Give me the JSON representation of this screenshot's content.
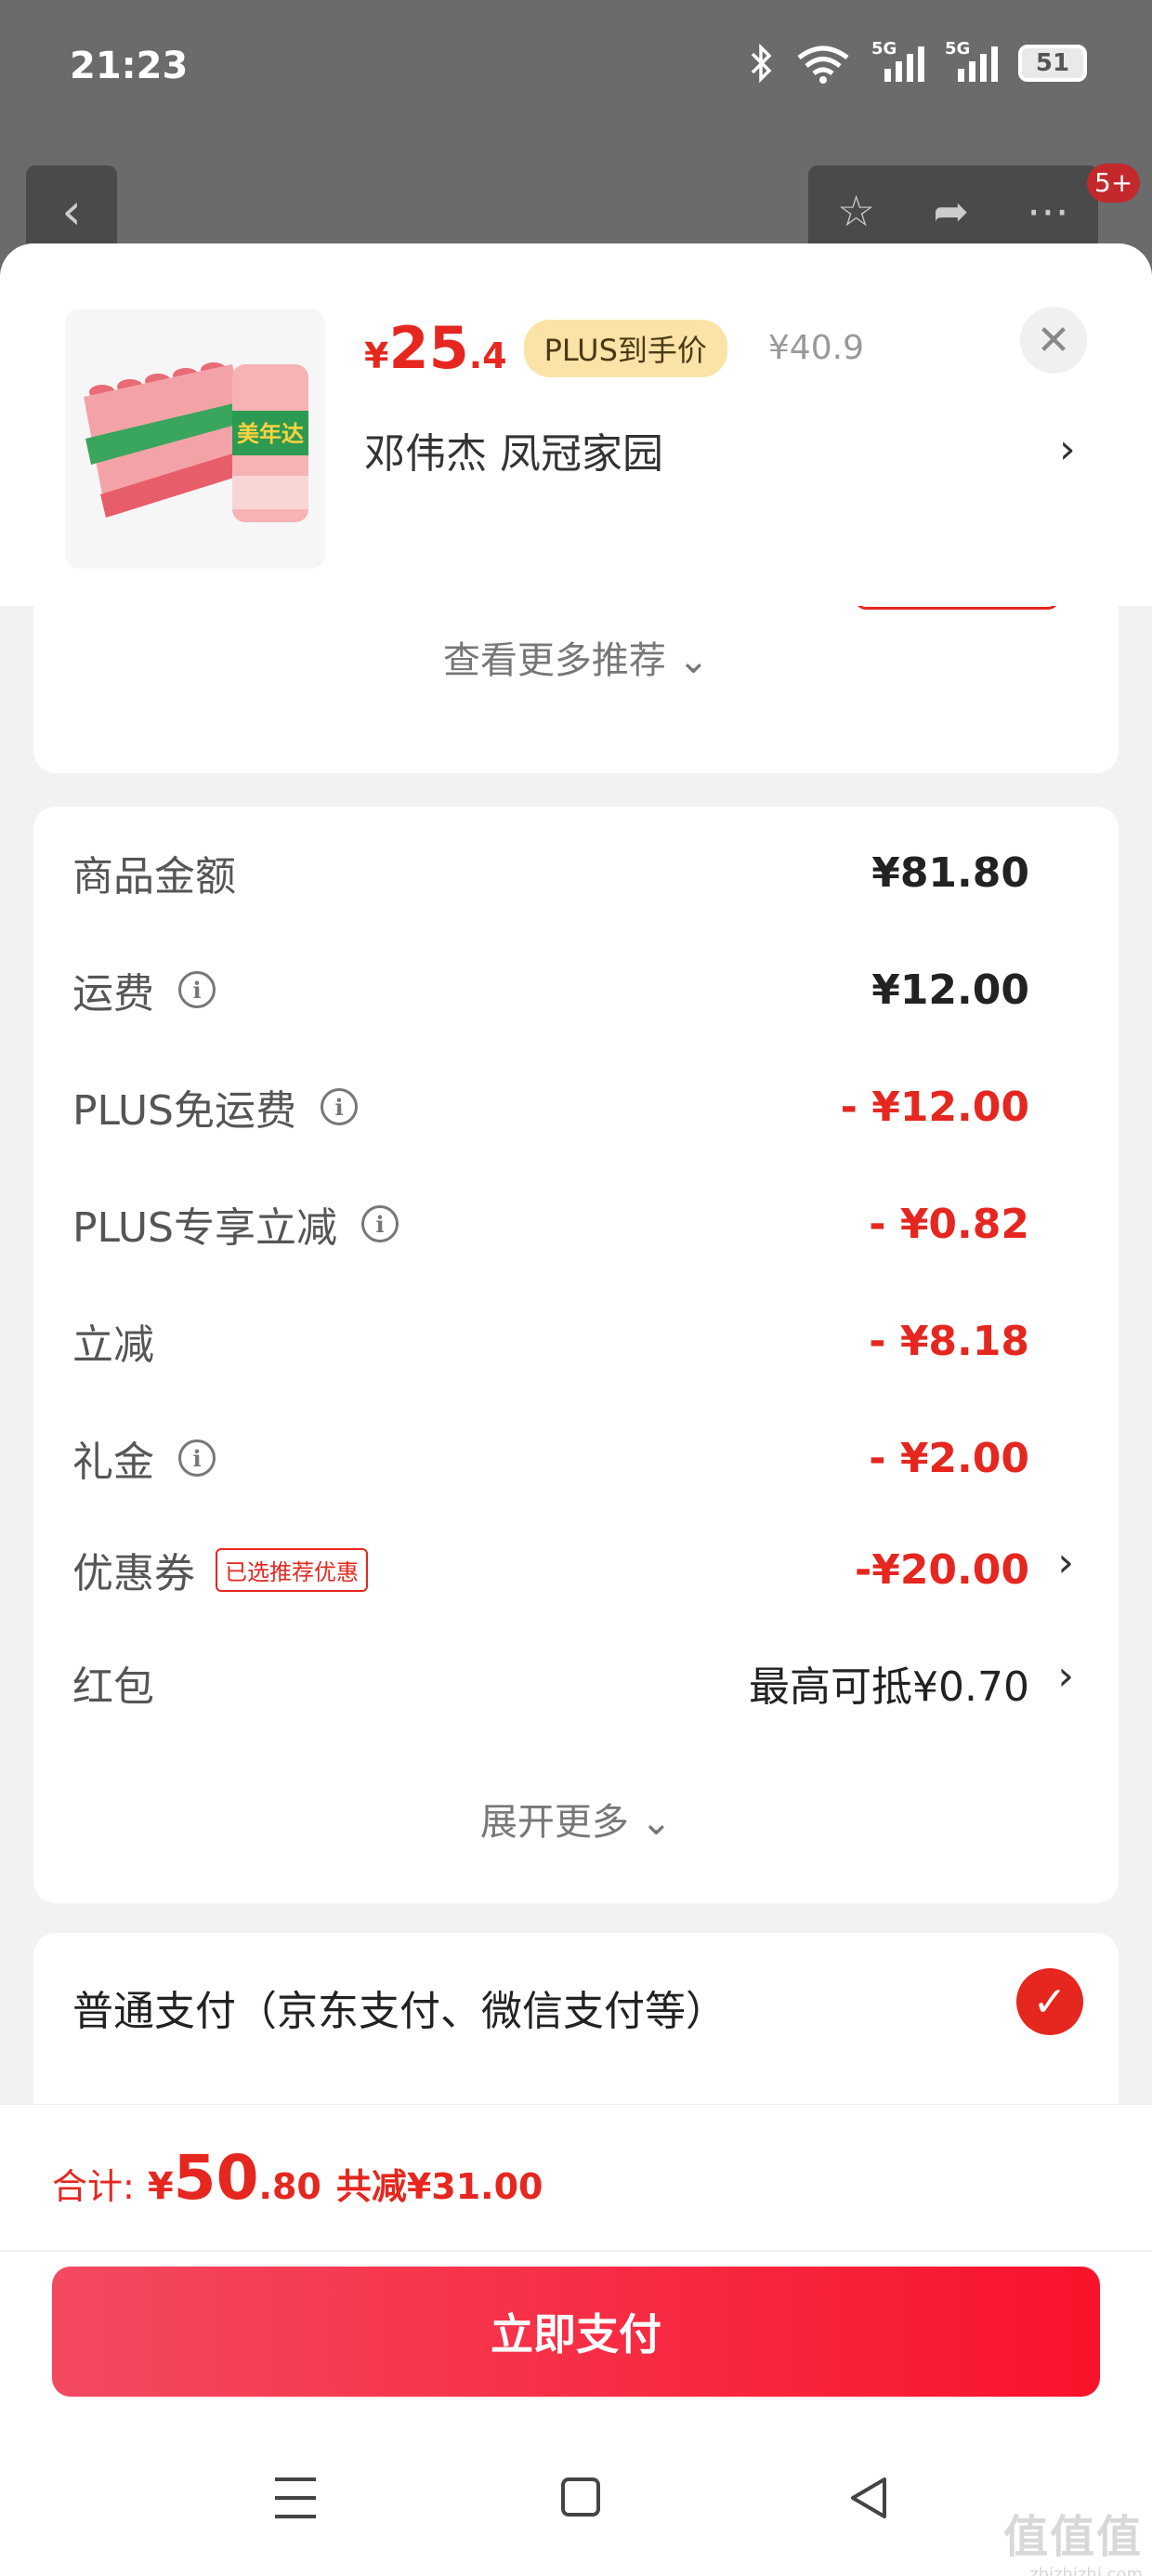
{
  "status_bar": {
    "time": "21:23",
    "signal1_label": "5G",
    "signal2_label": "5G",
    "battery": "51"
  },
  "behind": {
    "notification_badge": "5+"
  },
  "product": {
    "currency": "¥",
    "price_int": "25",
    "price_dec": ".4",
    "plus_tag": "PLUS到手价",
    "original_price": "¥40.9",
    "variant": "邓伟杰  凤冠家园",
    "image_brand_text": "美年达"
  },
  "recommend": {
    "more_label": "查看更多推荐 ⌄"
  },
  "fees": {
    "rows": [
      {
        "label": "商品金额",
        "value": "¥81.80"
      },
      {
        "label": "运费",
        "value": "¥12.00"
      },
      {
        "label": "PLUS免运费",
        "value": "- ¥12.00"
      },
      {
        "label": "PLUS专享立减",
        "value": "- ¥0.82"
      },
      {
        "label": "立减",
        "value": "- ¥8.18"
      },
      {
        "label": "礼金",
        "value": "- ¥2.00"
      },
      {
        "label": "优惠券",
        "tag": "已选推荐优惠",
        "value": "-¥20.00"
      },
      {
        "label": "红包",
        "value": "最高可抵¥0.70"
      }
    ],
    "expand_label": "展开更多 ⌄"
  },
  "payment": {
    "option1": "普通支付（京东支付、微信支付等）"
  },
  "summary": {
    "label": "合计:",
    "currency": "¥",
    "total_int": "50",
    "total_dec": ".80",
    "saved": "共减¥31.00"
  },
  "pay_button_label": "立即支付",
  "watermark": {
    "main": "值值值",
    "sub": "zhizhizhi.com"
  },
  "colors": {
    "accent_red": "#e5271f",
    "plus_tag_bg": "#fbe3a7",
    "button_gradient_start": "#f44a60",
    "button_gradient_end": "#f9132b"
  }
}
